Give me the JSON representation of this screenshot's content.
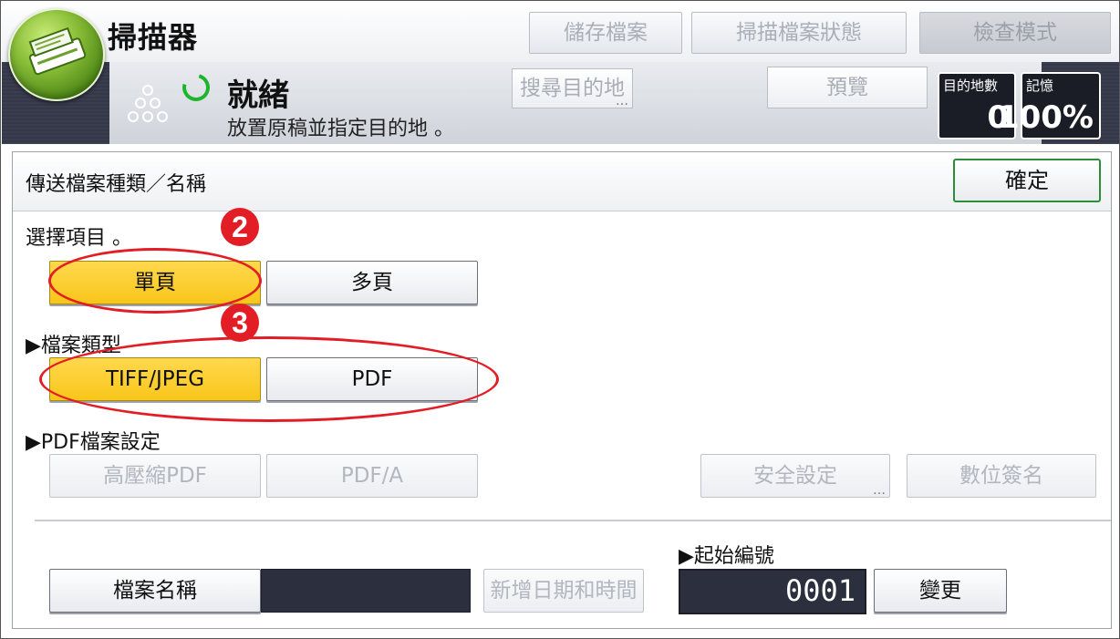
{
  "app": {
    "title": "掃描器"
  },
  "header": {
    "buttons": [
      {
        "label": "儲存檔案"
      },
      {
        "label": "掃描檔案狀態"
      },
      {
        "label": "檢查模式"
      }
    ]
  },
  "status": {
    "state": "就緒",
    "message": "放置原稿並指定目的地 。",
    "search_dest_label": "搜尋目的地",
    "preview_label": "預覽",
    "dest_count_label": "目的地數",
    "dest_count_value": "0",
    "memory_label": "記憶",
    "memory_value": "100%"
  },
  "panel": {
    "title": "傳送檔案種類／名稱",
    "ok_label": "確定",
    "select_prompt": "選擇項目 。",
    "page_options": [
      {
        "label": "單頁",
        "selected": true
      },
      {
        "label": "多頁",
        "selected": false
      }
    ],
    "file_type_heading": "▶檔案類型",
    "file_types": [
      {
        "label": "TIFF/JPEG",
        "selected": true
      },
      {
        "label": "PDF",
        "selected": false
      }
    ],
    "pdf_settings_heading": "▶PDF檔案設定",
    "pdf_buttons": [
      {
        "label": "高壓縮PDF"
      },
      {
        "label": "PDF/A"
      },
      {
        "label": "安全設定"
      },
      {
        "label": "數位簽名"
      }
    ],
    "file_name_label": "檔案名稱",
    "file_name_value": "",
    "add_datetime_label": "新增日期和時間",
    "start_number_heading": "▶起始編號",
    "start_number_value": "0001",
    "change_label": "變更"
  },
  "annotations": {
    "marker2": "2",
    "marker3": "3",
    "color": "#e21d25"
  },
  "colors": {
    "selected": "#f8c61a",
    "ok_border": "#2f8d3a",
    "status_bar": "#3a3e4d"
  }
}
